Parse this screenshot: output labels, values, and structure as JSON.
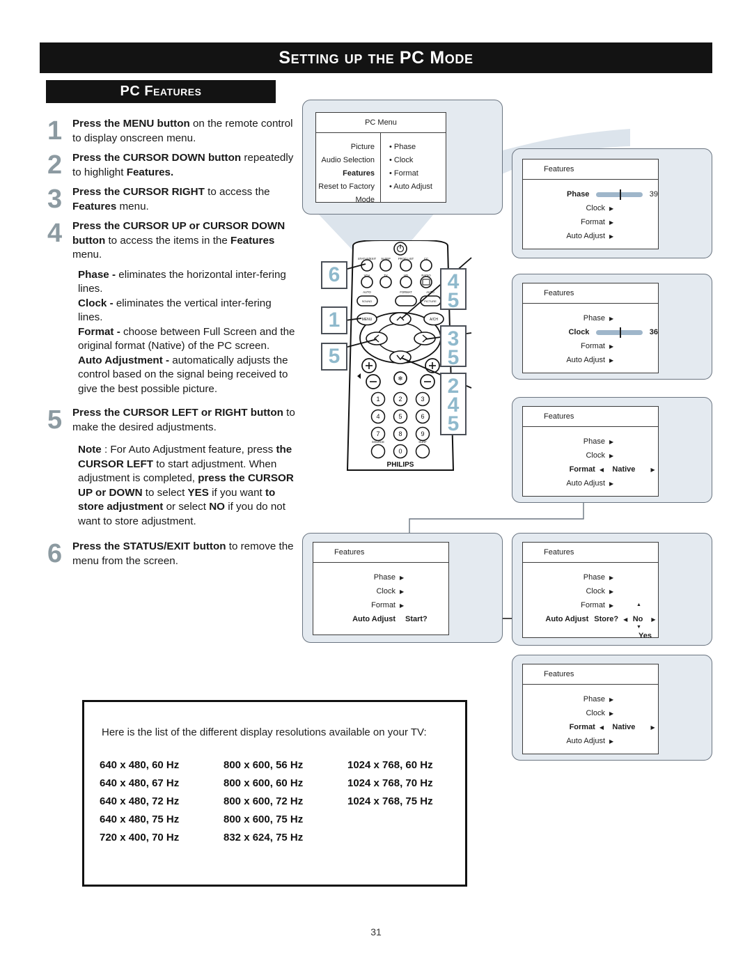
{
  "page": {
    "header_title": "Setting up the PC Mode",
    "section_title": "PC Features",
    "page_number": "31"
  },
  "steps": [
    {
      "number": "1",
      "html": "<b>Press the MENU button</b> on the remote control to display onscreen menu."
    },
    {
      "number": "2",
      "html": "<b>Press the CURSOR DOWN button</b> repeatedly to highlight <b>Features.</b>"
    },
    {
      "number": "3",
      "html": "<b>Press the CURSOR RIGHT</b> to access the <b>Features</b> menu."
    },
    {
      "number": "4",
      "html": "<b>Press the CURSOR UP or CURSOR DOWN button</b> to access the items in the <b>Features</b> menu."
    },
    {
      "number": "5",
      "html": "<b>Press the CURSOR LEFT or RIGHT button</b> to make the desired adjustments."
    },
    {
      "number": "6",
      "html": "<b>Press the STATUS/EXIT button</b> to remove the menu from the screen."
    }
  ],
  "definitions": [
    {
      "html": "<b>Phase -</b> eliminates the horizontal inter-fering lines."
    },
    {
      "html": "<b>Clock -</b> eliminates the vertical inter-fering lines."
    },
    {
      "html": "<b>Format -</b> choose between Full Screen and the original format (Native) of the PC screen."
    },
    {
      "html": "<b>Auto Adjustment -</b> automatically adjusts the control based on the signal being received to give the best possible picture."
    }
  ],
  "note": {
    "html": "<b>Note</b> : For Auto Adjustment feature, press <b>the CURSOR LEFT</b> to start adjustment. When adjustment is completed, <b>press the CURSOR UP or DOWN</b> to select <b>YES</b> if you want <b>to store adjustment</b> or select <b>NO</b> if you do not want to store adjustment."
  },
  "resolutions": {
    "intro": "Here is the list of the different display resolutions available on your TV:",
    "columns": [
      [
        "640 x 480, 60 Hz",
        "640 x 480, 67 Hz",
        "640 x 480, 72 Hz",
        "640 x 480, 75 Hz",
        "720 x 400, 70 Hz"
      ],
      [
        "800 x 600, 56 Hz",
        "800 x 600, 60 Hz",
        "800 x 600, 72 Hz",
        "800 x 600, 75 Hz",
        "832 x 624, 75 Hz"
      ],
      [
        "1024 x 768, 60 Hz",
        "1024 x 768, 70 Hz",
        "1024 x 768, 75 Hz",
        "",
        ""
      ]
    ]
  },
  "pc_menu": {
    "title": "PC Menu",
    "left_items": [
      {
        "label": "Picture",
        "bold": false
      },
      {
        "label": "Audio Selection",
        "bold": false
      },
      {
        "label": "Features",
        "bold": true
      },
      {
        "label": "Reset to Factory",
        "bold": false
      },
      {
        "label": "Mode",
        "bold": false
      }
    ],
    "right_items": [
      "• Phase",
      "• Clock",
      "• Format",
      "• Auto Adjust"
    ]
  },
  "features_panels": {
    "phase": {
      "title": "Features",
      "rows": [
        {
          "label": "Phase",
          "bold": true,
          "type": "slider",
          "value": "39",
          "knob_pct": 50
        },
        {
          "label": "Clock",
          "bold": false,
          "type": "arrow"
        },
        {
          "label": "Format",
          "bold": false,
          "type": "arrow"
        },
        {
          "label": "Auto Adjust",
          "bold": false,
          "type": "arrow"
        }
      ]
    },
    "clock": {
      "title": "Features",
      "rows": [
        {
          "label": "Phase",
          "bold": false,
          "type": "arrow"
        },
        {
          "label": "Clock",
          "bold": true,
          "type": "slider",
          "value": "36",
          "knob_pct": 50
        },
        {
          "label": "Format",
          "bold": false,
          "type": "arrow"
        },
        {
          "label": "Auto Adjust",
          "bold": false,
          "type": "arrow"
        }
      ]
    },
    "format_mid": {
      "title": "Features",
      "rows": [
        {
          "label": "Phase",
          "bold": false,
          "type": "arrow"
        },
        {
          "label": "Clock",
          "bold": false,
          "type": "arrow"
        },
        {
          "label": "Format",
          "bold": true,
          "type": "choice",
          "value": "Native"
        },
        {
          "label": "Auto Adjust",
          "bold": false,
          "type": "arrow"
        }
      ]
    },
    "auto_start": {
      "title": "Features",
      "rows": [
        {
          "label": "Phase",
          "bold": false,
          "type": "arrow"
        },
        {
          "label": "Clock",
          "bold": false,
          "type": "arrow"
        },
        {
          "label": "Format",
          "bold": false,
          "type": "arrow"
        },
        {
          "label": "Auto Adjust",
          "bold": true,
          "type": "text",
          "value": "Start?"
        }
      ]
    },
    "auto_store": {
      "title": "Features",
      "rows": [
        {
          "label": "Phase",
          "bold": false,
          "type": "arrow"
        },
        {
          "label": "Clock",
          "bold": false,
          "type": "arrow"
        },
        {
          "label": "Format",
          "bold": false,
          "type": "arrow"
        },
        {
          "label": "Auto Adjust",
          "bold": true,
          "type": "store",
          "prompt": "Store?",
          "value": "No",
          "alt": "Yes"
        }
      ]
    },
    "format_bottom": {
      "title": "Features",
      "rows": [
        {
          "label": "Phase",
          "bold": false,
          "type": "arrow"
        },
        {
          "label": "Clock",
          "bold": false,
          "type": "arrow"
        },
        {
          "label": "Format",
          "bold": true,
          "type": "choice",
          "value": "Native"
        },
        {
          "label": "Auto Adjust",
          "bold": false,
          "type": "arrow"
        }
      ]
    }
  },
  "remote": {
    "brand": "PHILIPS",
    "row_top": [
      "STATUS/EXIT",
      "SLEEP",
      "PROG.LIST",
      "CC"
    ],
    "row_source": [
      "VGA",
      "TV",
      "HD",
      "RADIO"
    ],
    "row_auto": [
      "AUTO SOUND",
      "FORMAT",
      "AUTO PICTURE"
    ],
    "menu_label": "MENU",
    "avch_label": "A/CH",
    "keypad": [
      "1",
      "2",
      "3",
      "4",
      "5",
      "6",
      "7",
      "8",
      "9",
      "0"
    ],
    "source_label": "SOURCE",
    "surf_label": "SURF",
    "callouts": [
      {
        "id": "callout-6",
        "digits": [
          "6"
        ]
      },
      {
        "id": "callout-1",
        "digits": [
          "1"
        ]
      },
      {
        "id": "callout-5",
        "digits": [
          "5"
        ]
      },
      {
        "id": "callout-45",
        "digits": [
          "4",
          "5"
        ]
      },
      {
        "id": "callout-35",
        "digits": [
          "3",
          "5"
        ]
      },
      {
        "id": "callout-245",
        "digits": [
          "2",
          "4",
          "5"
        ]
      }
    ]
  },
  "colors": {
    "banner_bg": "#131313",
    "step_number": "#8c9aa1",
    "shell_bg": "#e4eaf0",
    "slider": "#9fb6ca",
    "callout_text": "#8fb9cc"
  }
}
